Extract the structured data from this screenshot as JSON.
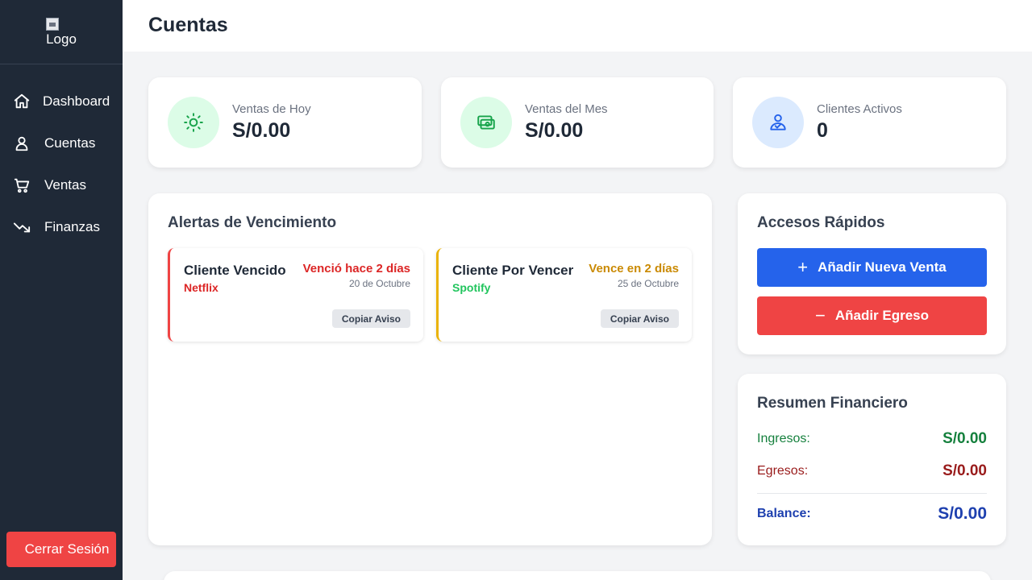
{
  "sidebar": {
    "logo_alt": "Logo",
    "items": [
      {
        "label": "Dashboard",
        "icon": "home-icon"
      },
      {
        "label": "Cuentas",
        "icon": "user-icon"
      },
      {
        "label": "Ventas",
        "icon": "cart-icon"
      },
      {
        "label": "Finanzas",
        "icon": "trending-down-icon"
      }
    ],
    "logout_label": "Cerrar Sesión"
  },
  "header": {
    "title": "Cuentas"
  },
  "stats": [
    {
      "label": "Ventas de Hoy",
      "value": "S/0.00",
      "icon": "sun-icon",
      "color": "#16a34a",
      "bg": "#dcfce7"
    },
    {
      "label": "Ventas del Mes",
      "value": "S/0.00",
      "icon": "money-icon",
      "color": "#16a34a",
      "bg": "#dcfce7"
    },
    {
      "label": "Clientes Activos",
      "value": "0",
      "icon": "user-check-icon",
      "color": "#2563eb",
      "bg": "#dbeafe"
    }
  ],
  "alerts": {
    "title": "Alertas de Vencimiento",
    "items": [
      {
        "name": "Cliente Vencido",
        "service": "Netflix",
        "status": "Venció hace 2 días",
        "date": "20 de Octubre",
        "button": "Copiar Aviso",
        "color": "#dc2626"
      },
      {
        "name": "Cliente Por Vencer",
        "service": "Spotify",
        "status": "Vence en 2 días",
        "date": "25 de Octubre",
        "button": "Copiar Aviso",
        "color": "#ca8a04",
        "service_color": "#22c55e"
      }
    ]
  },
  "quick": {
    "title": "Accesos Rápidos",
    "add_sale": "Añadir Nueva Venta",
    "add_expense": "Añadir Egreso",
    "add_sale_color": "#2563eb",
    "add_expense_color": "#ef4444"
  },
  "finance": {
    "title": "Resumen Financiero",
    "income_label": "Ingresos:",
    "income_value": "S/0.00",
    "income_color": "#15803d",
    "expense_label": "Egresos:",
    "expense_value": "S/0.00",
    "expense_color": "#991b1b",
    "balance_label": "Balance:",
    "balance_value": "S/0.00",
    "balance_color": "#1e40af"
  }
}
